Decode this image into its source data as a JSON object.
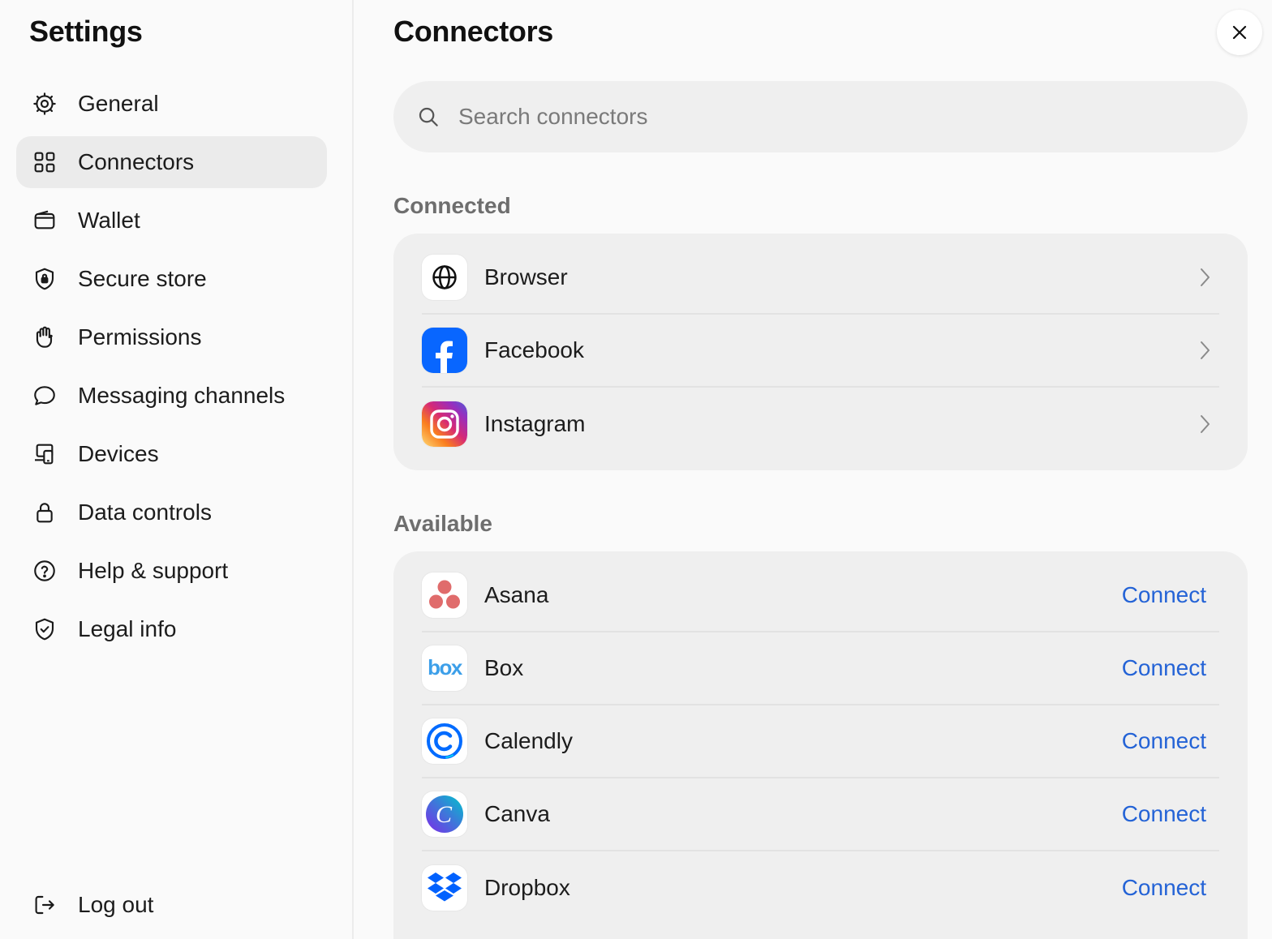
{
  "sidebar": {
    "title": "Settings",
    "items": [
      {
        "label": "General",
        "icon": "gear-icon"
      },
      {
        "label": "Connectors",
        "icon": "grid-icon",
        "active": true
      },
      {
        "label": "Wallet",
        "icon": "wallet-icon"
      },
      {
        "label": "Secure store",
        "icon": "shield-lock-icon"
      },
      {
        "label": "Permissions",
        "icon": "hand-icon"
      },
      {
        "label": "Messaging channels",
        "icon": "chat-bubble-icon"
      },
      {
        "label": "Devices",
        "icon": "devices-icon"
      },
      {
        "label": "Data controls",
        "icon": "lock-icon"
      },
      {
        "label": "Help & support",
        "icon": "help-circle-icon"
      },
      {
        "label": "Legal info",
        "icon": "shield-check-icon"
      }
    ],
    "logout": {
      "label": "Log out",
      "icon": "logout-icon"
    }
  },
  "main": {
    "title": "Connectors",
    "search": {
      "placeholder": "Search connectors",
      "value": ""
    },
    "connected": {
      "label": "Connected",
      "items": [
        {
          "name": "Browser",
          "icon": "globe-icon"
        },
        {
          "name": "Facebook",
          "icon": "facebook-icon"
        },
        {
          "name": "Instagram",
          "icon": "instagram-icon"
        }
      ]
    },
    "available": {
      "label": "Available",
      "action_label": "Connect",
      "items": [
        {
          "name": "Asana",
          "icon": "asana-icon",
          "action": "Connect"
        },
        {
          "name": "Box",
          "icon": "box-icon",
          "action": "Connect"
        },
        {
          "name": "Calendly",
          "icon": "calendly-icon",
          "action": "Connect"
        },
        {
          "name": "Canva",
          "icon": "canva-icon",
          "action": "Connect"
        },
        {
          "name": "Dropbox",
          "icon": "dropbox-icon",
          "action": "Connect"
        }
      ]
    }
  },
  "colors": {
    "accent": "#2463d6",
    "active_bg": "#ebebeb",
    "card_bg": "#efefef",
    "facebook": "#0866ff",
    "asana": "#e06c6c",
    "box": "#3c9fe9",
    "dropbox": "#0061fe"
  }
}
